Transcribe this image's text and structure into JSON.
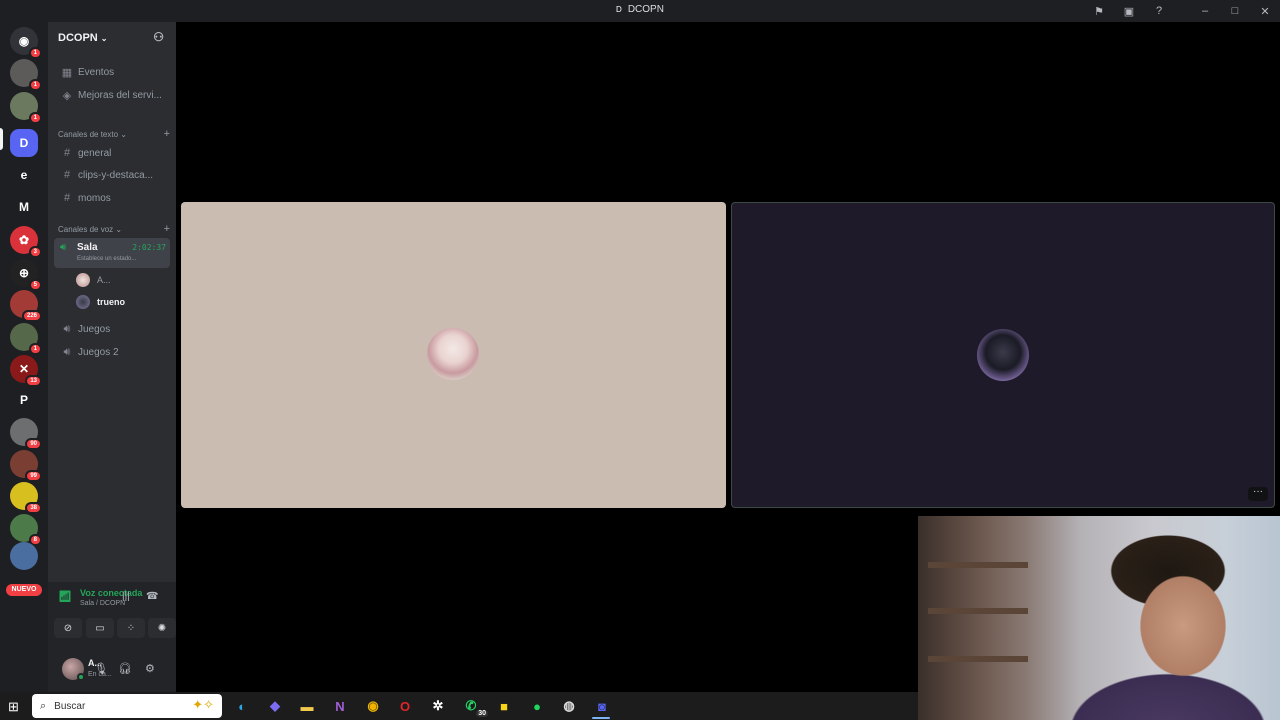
{
  "window": {
    "title": "DCOPN",
    "logo_letter": "D"
  },
  "guilds": [
    {
      "name": "home",
      "glyph": "◉",
      "badge": "1",
      "color": "#313338"
    },
    {
      "name": "server-1",
      "glyph": "",
      "badge": "1",
      "color": "#5c5b5a"
    },
    {
      "name": "server-2",
      "glyph": "",
      "badge": "1",
      "color": "#6b7a5f"
    },
    {
      "name": "server-dcopn",
      "glyph": "D",
      "badge": "",
      "color": "#5865f2"
    },
    {
      "name": "server-e",
      "glyph": "e",
      "badge": "",
      "color": "#1e1f22"
    },
    {
      "name": "server-m",
      "glyph": "M",
      "badge": "",
      "color": "#1e1f22"
    },
    {
      "name": "server-red",
      "glyph": "✿",
      "badge": "3",
      "color": "#d9323b"
    },
    {
      "name": "server-bw",
      "glyph": "⊕",
      "badge": "5",
      "color": "#222"
    },
    {
      "name": "server-fire",
      "glyph": "",
      "badge": "226",
      "color": "#a23a36"
    },
    {
      "name": "server-anime",
      "glyph": "",
      "badge": "1",
      "color": "#55684a"
    },
    {
      "name": "server-x",
      "glyph": "✕",
      "badge": "13",
      "color": "#8a1a1a"
    },
    {
      "name": "server-p",
      "glyph": "P",
      "badge": "",
      "color": "#1e1f22"
    },
    {
      "name": "server-90",
      "glyph": "",
      "badge": "90",
      "color": "#6d6e6f"
    },
    {
      "name": "server-99",
      "glyph": "",
      "badge": "99",
      "color": "#7a3e33"
    },
    {
      "name": "server-38",
      "glyph": "",
      "badge": "38",
      "color": "#d6bf1f"
    },
    {
      "name": "server-8",
      "glyph": "",
      "badge": "8",
      "color": "#4c7a49"
    },
    {
      "name": "server-last",
      "glyph": "",
      "badge": "",
      "color": "#4a6ea0"
    }
  ],
  "nuevo_label": "NUEVO",
  "server": {
    "name": "DCOPN"
  },
  "top_items": [
    {
      "icon": "▦",
      "label": "Eventos"
    },
    {
      "icon": "◈",
      "label": "Mejoras del servi..."
    }
  ],
  "text_category": "Canales de texto",
  "text_channels": [
    "general",
    "clips-y-destaca...",
    "momos"
  ],
  "voice_category": "Canales de voz",
  "active_voice": {
    "name": "Sala",
    "time": "2:02:37",
    "status": "Establece un estado..."
  },
  "members": [
    {
      "name": "A...",
      "color": "#b98c8c"
    },
    {
      "name": "trueno",
      "color": "#3a3a46"
    }
  ],
  "other_voice": [
    "Juegos",
    "Juegos 2"
  ],
  "voice_panel": {
    "title": "Voz conectada",
    "subtitle": "Sala / DCOPN"
  },
  "user": {
    "name": "A...",
    "status": "En ca..."
  },
  "taskbar": {
    "search_placeholder": "Buscar",
    "apps": [
      {
        "name": "edge",
        "glyph": "◐",
        "color": "#2aa7e4",
        "badge": ""
      },
      {
        "name": "copilot",
        "glyph": "◆",
        "color": "#7c6cf2",
        "badge": ""
      },
      {
        "name": "explorer",
        "glyph": "▬",
        "color": "#f2c94c",
        "badge": ""
      },
      {
        "name": "onenote",
        "glyph": "N",
        "color": "#a05fd6",
        "badge": ""
      },
      {
        "name": "chrome",
        "glyph": "◉",
        "color": "#f0b400",
        "badge": ""
      },
      {
        "name": "opera",
        "glyph": "O",
        "color": "#e3242b",
        "badge": ""
      },
      {
        "name": "chatgpt",
        "glyph": "✲",
        "color": "#ffffff",
        "badge": ""
      },
      {
        "name": "whatsapp",
        "glyph": "✆",
        "color": "#25d366",
        "badge": "30"
      },
      {
        "name": "sticky-notes",
        "glyph": "■",
        "color": "#f7d417",
        "badge": ""
      },
      {
        "name": "spotify",
        "glyph": "●",
        "color": "#1ed760",
        "badge": ""
      },
      {
        "name": "github",
        "glyph": "◍",
        "color": "#dddddd",
        "badge": ""
      },
      {
        "name": "discord",
        "glyph": "◙",
        "color": "#5865f2",
        "badge": ""
      }
    ]
  }
}
